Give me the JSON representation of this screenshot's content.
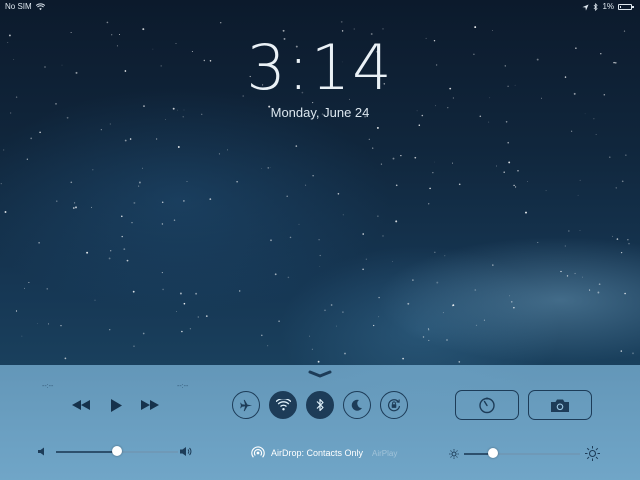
{
  "status_bar": {
    "carrier": "No SIM",
    "battery": "1%",
    "battery_level": 0.01
  },
  "lock_screen": {
    "time": "3:14",
    "date": "Monday, June 24"
  },
  "control_center": {
    "now_playing": {
      "elapsed": "--:--",
      "remaining": "--:--"
    },
    "media": {
      "rewind_icon": "rewind-icon",
      "play_icon": "play-icon",
      "forward_icon": "fast-forward-icon"
    },
    "volume_level": 0.5,
    "brightness_level": 0.25,
    "toggles": [
      {
        "name": "airplane-mode",
        "icon": "airplane-icon",
        "active": false
      },
      {
        "name": "wifi",
        "icon": "wifi-icon",
        "active": true
      },
      {
        "name": "bluetooth",
        "icon": "bluetooth-icon",
        "active": true
      },
      {
        "name": "do-not-disturb",
        "icon": "moon-icon",
        "active": false
      },
      {
        "name": "rotation-lock",
        "icon": "rotation-lock-icon",
        "active": false
      }
    ],
    "airdrop_label": "AirDrop: Contacts Only",
    "airplay_label": "AirPlay",
    "shortcuts": [
      {
        "name": "timer",
        "icon": "timer-icon"
      },
      {
        "name": "camera",
        "icon": "camera-icon"
      }
    ],
    "colors": {
      "dark": "#1d3c58",
      "panel": "#82b9dc"
    }
  }
}
